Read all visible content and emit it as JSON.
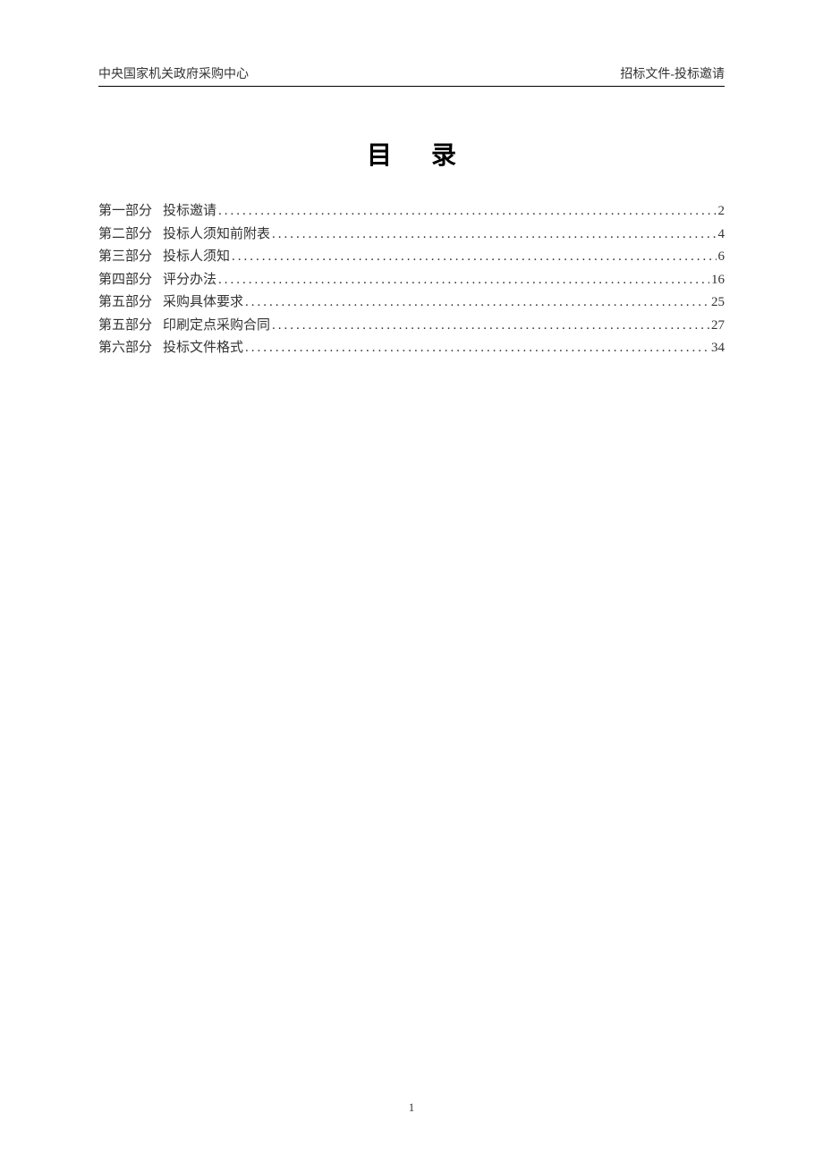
{
  "header": {
    "left": "中央国家机关政府采购中心",
    "right": "招标文件-投标邀请"
  },
  "title": "目录",
  "toc": [
    {
      "section": "第一部分",
      "title": "投标邀请",
      "page": "2"
    },
    {
      "section": "第二部分",
      "title": "投标人须知前附表",
      "page": "4"
    },
    {
      "section": "第三部分",
      "title": "投标人须知",
      "page": "6"
    },
    {
      "section": "第四部分",
      "title": "评分办法",
      "page": "16"
    },
    {
      "section": "第五部分",
      "title": "采购具体要求",
      "page": "25"
    },
    {
      "section": "第五部分",
      "title": "印刷定点采购合同",
      "page": "27"
    },
    {
      "section": "第六部分",
      "title": "投标文件格式",
      "page": "34"
    }
  ],
  "footer": {
    "page_number": "1"
  }
}
